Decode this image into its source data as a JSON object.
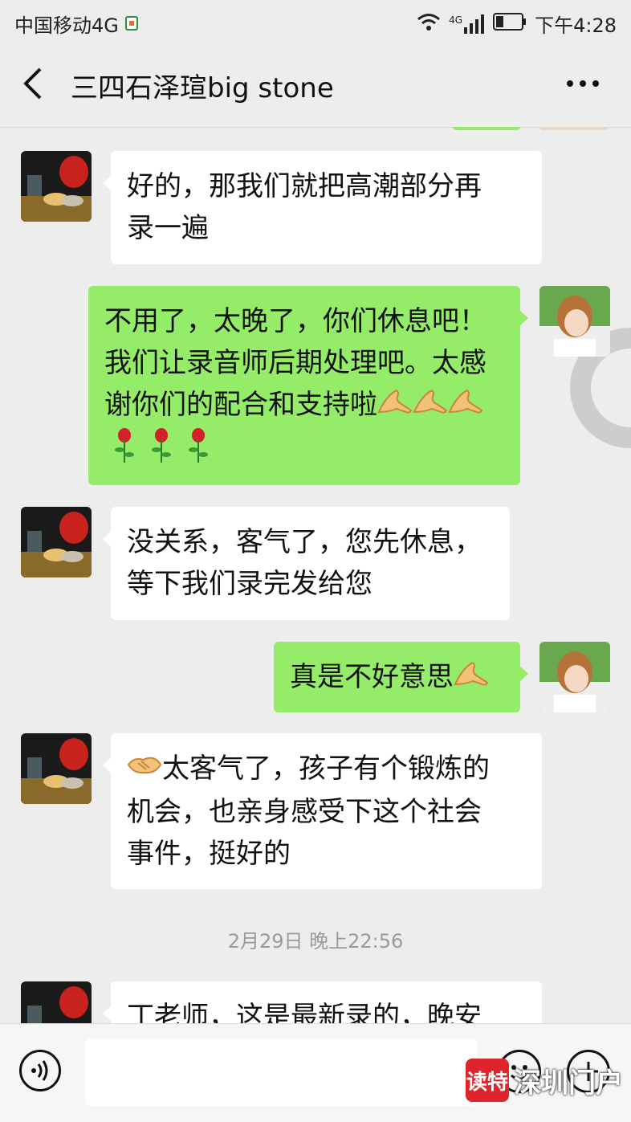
{
  "status_bar": {
    "carrier": "中国移动4G",
    "time": "下午4:28",
    "network_label": "4G"
  },
  "header": {
    "title": "三四石泽瑄big stone"
  },
  "messages": [
    {
      "side": "left",
      "avatar": "tea-set-avatar",
      "lines": [
        "好的，那我们就把高潮部分再",
        "录一遍"
      ]
    },
    {
      "side": "right",
      "avatar": "girl-avatar",
      "lines": [
        "不用了，太晚了，你们休息吧！",
        "我们让录音师后期处理吧。太感",
        "谢你们的配合和支持啦"
      ],
      "trailing_emoji": "ok-hand-emoji x3",
      "extra_line_emoji": "rose-emoji x3"
    },
    {
      "side": "left",
      "avatar": "tea-set-avatar",
      "lines": [
        "没关系，客气了，您先休息，",
        "等下我们录完发给您"
      ]
    },
    {
      "side": "right",
      "avatar": "girl-avatar",
      "lines": [
        "真是不好意思"
      ],
      "trailing_emoji": "ok-hand-emoji"
    },
    {
      "side": "left",
      "avatar": "tea-set-avatar",
      "lines": [
        "太客气了，孩子有个锻炼的",
        "机会，也亲身感受下这个社会",
        "事件，挺好的"
      ],
      "leading_emoji": "handshake-emoji"
    },
    {
      "side": "left",
      "avatar": "tea-set-avatar",
      "lines": [
        "丁老师，这是最新录的，晚安"
      ]
    }
  ],
  "timestamp": "2月29日 晚上22:56",
  "input": {
    "placeholder": ""
  },
  "watermark": {
    "badge": "读特",
    "text": "深圳门户"
  },
  "colors": {
    "background": "#ededed",
    "sent_bubble": "#95ec69",
    "received_bubble": "#ffffff"
  }
}
